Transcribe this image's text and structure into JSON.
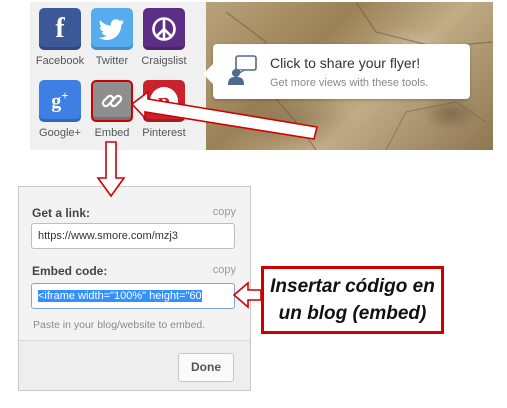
{
  "share_icons": [
    {
      "label": "Facebook"
    },
    {
      "label": "Twitter"
    },
    {
      "label": "Craigslist"
    },
    {
      "label": "Google+"
    },
    {
      "label": "Embed"
    },
    {
      "label": "Pinterest"
    }
  ],
  "callout": {
    "title": "Click to share your flyer!",
    "subtitle": "Get more views with these tools."
  },
  "dialog": {
    "link_label": "Get a link:",
    "link_copy": "copy",
    "link_value": "https://www.smore.com/mzj3",
    "embed_label": "Embed code:",
    "embed_copy": "copy",
    "embed_value": "<iframe width=\"100%\" height=\"60",
    "help_text": "Paste in your blog/website to embed.",
    "done_label": "Done"
  },
  "annotation": {
    "line1": "Insertar código en",
    "line2": "un blog (embed)"
  },
  "colors": {
    "facebook": "#3b5998",
    "twitter": "#55acee",
    "craigslist": "#5d2e86",
    "google": "#3d7fe2",
    "embed": "#8e8e8e",
    "pinterest": "#c8232c",
    "annotation_red": "#d10000",
    "selection": "#3390ff"
  }
}
